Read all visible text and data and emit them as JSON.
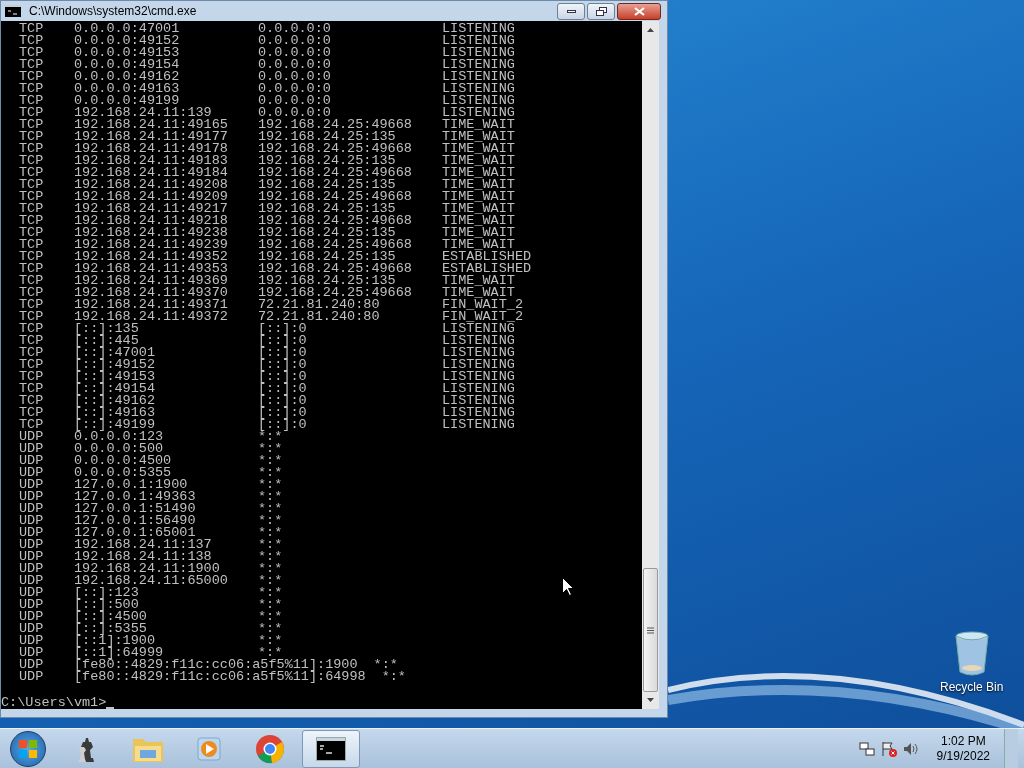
{
  "window": {
    "title": "C:\\Windows\\system32\\cmd.exe"
  },
  "console": {
    "rows": [
      {
        "proto": "TCP",
        "local": "0.0.0.0:47001",
        "foreign": "0.0.0.0:0",
        "state": "LISTENING"
      },
      {
        "proto": "TCP",
        "local": "0.0.0.0:49152",
        "foreign": "0.0.0.0:0",
        "state": "LISTENING"
      },
      {
        "proto": "TCP",
        "local": "0.0.0.0:49153",
        "foreign": "0.0.0.0:0",
        "state": "LISTENING"
      },
      {
        "proto": "TCP",
        "local": "0.0.0.0:49154",
        "foreign": "0.0.0.0:0",
        "state": "LISTENING"
      },
      {
        "proto": "TCP",
        "local": "0.0.0.0:49162",
        "foreign": "0.0.0.0:0",
        "state": "LISTENING"
      },
      {
        "proto": "TCP",
        "local": "0.0.0.0:49163",
        "foreign": "0.0.0.0:0",
        "state": "LISTENING"
      },
      {
        "proto": "TCP",
        "local": "0.0.0.0:49199",
        "foreign": "0.0.0.0:0",
        "state": "LISTENING"
      },
      {
        "proto": "TCP",
        "local": "192.168.24.11:139",
        "foreign": "0.0.0.0:0",
        "state": "LISTENING"
      },
      {
        "proto": "TCP",
        "local": "192.168.24.11:49165",
        "foreign": "192.168.24.25:49668",
        "state": "TIME_WAIT"
      },
      {
        "proto": "TCP",
        "local": "192.168.24.11:49177",
        "foreign": "192.168.24.25:135",
        "state": "TIME_WAIT"
      },
      {
        "proto": "TCP",
        "local": "192.168.24.11:49178",
        "foreign": "192.168.24.25:49668",
        "state": "TIME_WAIT"
      },
      {
        "proto": "TCP",
        "local": "192.168.24.11:49183",
        "foreign": "192.168.24.25:135",
        "state": "TIME_WAIT"
      },
      {
        "proto": "TCP",
        "local": "192.168.24.11:49184",
        "foreign": "192.168.24.25:49668",
        "state": "TIME_WAIT"
      },
      {
        "proto": "TCP",
        "local": "192.168.24.11:49208",
        "foreign": "192.168.24.25:135",
        "state": "TIME_WAIT"
      },
      {
        "proto": "TCP",
        "local": "192.168.24.11:49209",
        "foreign": "192.168.24.25:49668",
        "state": "TIME_WAIT"
      },
      {
        "proto": "TCP",
        "local": "192.168.24.11:49217",
        "foreign": "192.168.24.25:135",
        "state": "TIME_WAIT"
      },
      {
        "proto": "TCP",
        "local": "192.168.24.11:49218",
        "foreign": "192.168.24.25:49668",
        "state": "TIME_WAIT"
      },
      {
        "proto": "TCP",
        "local": "192.168.24.11:49238",
        "foreign": "192.168.24.25:135",
        "state": "TIME_WAIT"
      },
      {
        "proto": "TCP",
        "local": "192.168.24.11:49239",
        "foreign": "192.168.24.25:49668",
        "state": "TIME_WAIT"
      },
      {
        "proto": "TCP",
        "local": "192.168.24.11:49352",
        "foreign": "192.168.24.25:135",
        "state": "ESTABLISHED"
      },
      {
        "proto": "TCP",
        "local": "192.168.24.11:49353",
        "foreign": "192.168.24.25:49668",
        "state": "ESTABLISHED"
      },
      {
        "proto": "TCP",
        "local": "192.168.24.11:49369",
        "foreign": "192.168.24.25:135",
        "state": "TIME_WAIT"
      },
      {
        "proto": "TCP",
        "local": "192.168.24.11:49370",
        "foreign": "192.168.24.25:49668",
        "state": "TIME_WAIT"
      },
      {
        "proto": "TCP",
        "local": "192.168.24.11:49371",
        "foreign": "72.21.81.240:80",
        "state": "FIN_WAIT_2"
      },
      {
        "proto": "TCP",
        "local": "192.168.24.11:49372",
        "foreign": "72.21.81.240:80",
        "state": "FIN_WAIT_2"
      },
      {
        "proto": "TCP",
        "local": "[::]:135",
        "foreign": "[::]:0",
        "state": "LISTENING"
      },
      {
        "proto": "TCP",
        "local": "[::]:445",
        "foreign": "[::]:0",
        "state": "LISTENING"
      },
      {
        "proto": "TCP",
        "local": "[::]:47001",
        "foreign": "[::]:0",
        "state": "LISTENING"
      },
      {
        "proto": "TCP",
        "local": "[::]:49152",
        "foreign": "[::]:0",
        "state": "LISTENING"
      },
      {
        "proto": "TCP",
        "local": "[::]:49153",
        "foreign": "[::]:0",
        "state": "LISTENING"
      },
      {
        "proto": "TCP",
        "local": "[::]:49154",
        "foreign": "[::]:0",
        "state": "LISTENING"
      },
      {
        "proto": "TCP",
        "local": "[::]:49162",
        "foreign": "[::]:0",
        "state": "LISTENING"
      },
      {
        "proto": "TCP",
        "local": "[::]:49163",
        "foreign": "[::]:0",
        "state": "LISTENING"
      },
      {
        "proto": "TCP",
        "local": "[::]:49199",
        "foreign": "[::]:0",
        "state": "LISTENING"
      },
      {
        "proto": "UDP",
        "local": "0.0.0.0:123",
        "foreign": "*:*"
      },
      {
        "proto": "UDP",
        "local": "0.0.0.0:500",
        "foreign": "*:*"
      },
      {
        "proto": "UDP",
        "local": "0.0.0.0:4500",
        "foreign": "*:*"
      },
      {
        "proto": "UDP",
        "local": "0.0.0.0:5355",
        "foreign": "*:*"
      },
      {
        "proto": "UDP",
        "local": "127.0.0.1:1900",
        "foreign": "*:*"
      },
      {
        "proto": "UDP",
        "local": "127.0.0.1:49363",
        "foreign": "*:*"
      },
      {
        "proto": "UDP",
        "local": "127.0.0.1:51490",
        "foreign": "*:*"
      },
      {
        "proto": "UDP",
        "local": "127.0.0.1:56490",
        "foreign": "*:*"
      },
      {
        "proto": "UDP",
        "local": "127.0.0.1:65001",
        "foreign": "*:*"
      },
      {
        "proto": "UDP",
        "local": "192.168.24.11:137",
        "foreign": "*:*"
      },
      {
        "proto": "UDP",
        "local": "192.168.24.11:138",
        "foreign": "*:*"
      },
      {
        "proto": "UDP",
        "local": "192.168.24.11:1900",
        "foreign": "*:*"
      },
      {
        "proto": "UDP",
        "local": "192.168.24.11:65000",
        "foreign": "*:*"
      },
      {
        "proto": "UDP",
        "local": "[::]:123",
        "foreign": "*:*"
      },
      {
        "proto": "UDP",
        "local": "[::]:500",
        "foreign": "*:*"
      },
      {
        "proto": "UDP",
        "local": "[::]:4500",
        "foreign": "*:*"
      },
      {
        "proto": "UDP",
        "local": "[::]:5355",
        "foreign": "*:*"
      },
      {
        "proto": "UDP",
        "local": "[::1]:1900",
        "foreign": "*:*"
      },
      {
        "proto": "UDP",
        "local": "[::1]:64999",
        "foreign": "*:*"
      },
      {
        "proto": "UDP",
        "local": "[fe80::4829:f11c:cc06:a5f5%11]:1900",
        "foreign": "*:*"
      },
      {
        "proto": "UDP",
        "local": "[fe80::4829:f11c:cc06:a5f5%11]:64998",
        "foreign": "*:*"
      }
    ],
    "prompt": "C:\\Users\\vm1>"
  },
  "desktop": {
    "icons": [
      {
        "label": "Recycle Bin"
      }
    ]
  },
  "taskbar": {
    "apps": [
      {
        "kind": "chess",
        "selected": false
      },
      {
        "kind": "folder",
        "selected": false
      },
      {
        "kind": "media",
        "selected": false
      },
      {
        "kind": "browser",
        "selected": false
      },
      {
        "kind": "console",
        "selected": true
      }
    ],
    "tray": {
      "time": "1:02 PM",
      "date": "9/19/2022"
    }
  }
}
